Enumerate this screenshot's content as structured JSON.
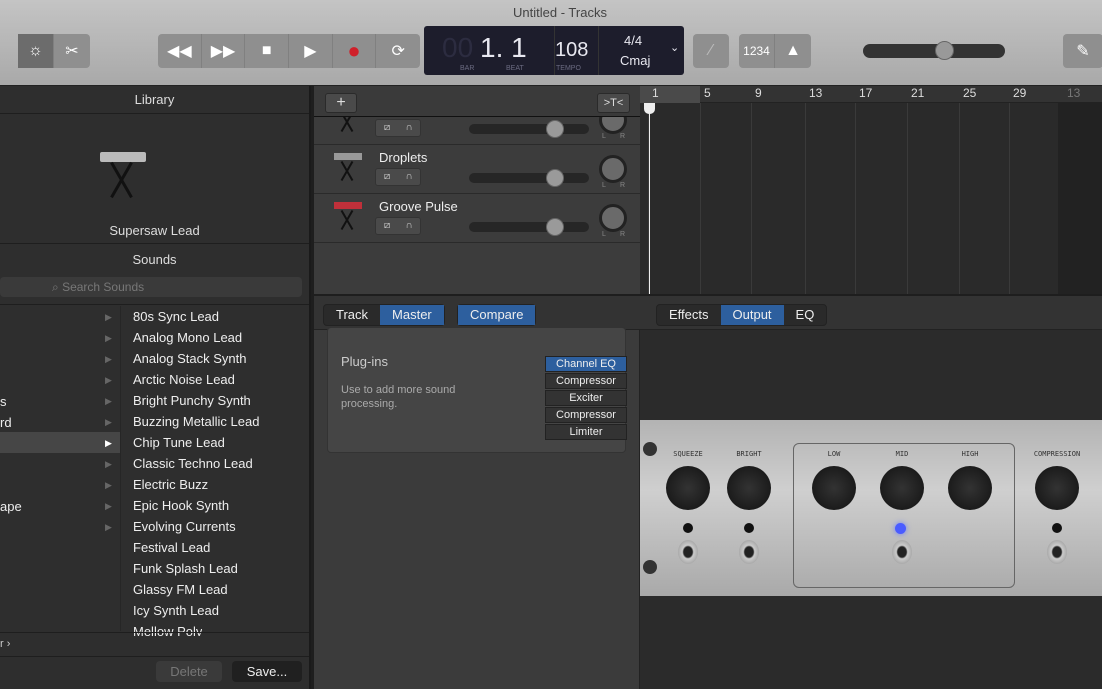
{
  "window": {
    "title": "Untitled - Tracks"
  },
  "transport": {
    "rewind": "◀◀",
    "forward": "▶▶",
    "stop": "■",
    "play": "▶",
    "record": "●",
    "cycle": "⟳"
  },
  "lcd": {
    "bar_dim": "00",
    "position": "1. 1",
    "bar_label": "BAR",
    "beat_label": "BEAT",
    "tempo": "108",
    "tempo_label": "TEMPO",
    "signature": "4/4",
    "key": "Cmaj"
  },
  "toolbar": {
    "count_in": "1234",
    "master_volume": 0.6
  },
  "library": {
    "header": "Library",
    "instrument": "Supersaw Lead",
    "sounds_header": "Sounds",
    "search_placeholder": "Search Sounds",
    "categories": [
      "",
      "",
      "",
      "",
      "s",
      "rd",
      "",
      "",
      "",
      "ape",
      ""
    ],
    "selected_category_index": 6,
    "sounds": [
      "80s Sync Lead",
      "Analog Mono Lead",
      "Analog Stack Synth",
      "Arctic Noise Lead",
      "Bright Punchy Synth",
      "Buzzing Metallic Lead",
      "Chip Tune Lead",
      "Classic Techno Lead",
      "Electric Buzz",
      "Epic Hook Synth",
      "Evolving Currents",
      "Festival Lead",
      "Funk Splash Lead",
      "Glassy FM Lead",
      "Icy Synth Lead",
      "Mellow Poly"
    ],
    "path": "r ›",
    "delete": "Delete",
    "save": "Save..."
  },
  "tracks": {
    "add": "+",
    "rows": [
      {
        "name": ""
      },
      {
        "name": "Droplets"
      },
      {
        "name": "Groove Pulse"
      }
    ],
    "volume": 0.72,
    "pan_l": "L",
    "pan_r": "R"
  },
  "ruler": [
    "1",
    "5",
    "9",
    "13",
    "17",
    "21",
    "25",
    "29",
    "13"
  ],
  "smart_controls": {
    "left_tabs": [
      "Track",
      "Master"
    ],
    "active_left": "Master",
    "compare": "Compare",
    "right_tabs": [
      "Effects",
      "Output",
      "EQ"
    ],
    "active_right": "Output",
    "plugins_title": "Plug-ins",
    "plugins_desc": "Use to add more sound processing.",
    "plugins": [
      "Channel EQ",
      "Compressor",
      "Exciter",
      "Compressor",
      "Limiter"
    ],
    "knobs": [
      "SQUEEZE",
      "BRIGHT",
      "LOW",
      "MID",
      "HIGH",
      "COMPRESSION"
    ]
  },
  "colors": {
    "accent": "#2d5f9e",
    "record": "#d0202a",
    "eq_led": "#4a5cff"
  }
}
